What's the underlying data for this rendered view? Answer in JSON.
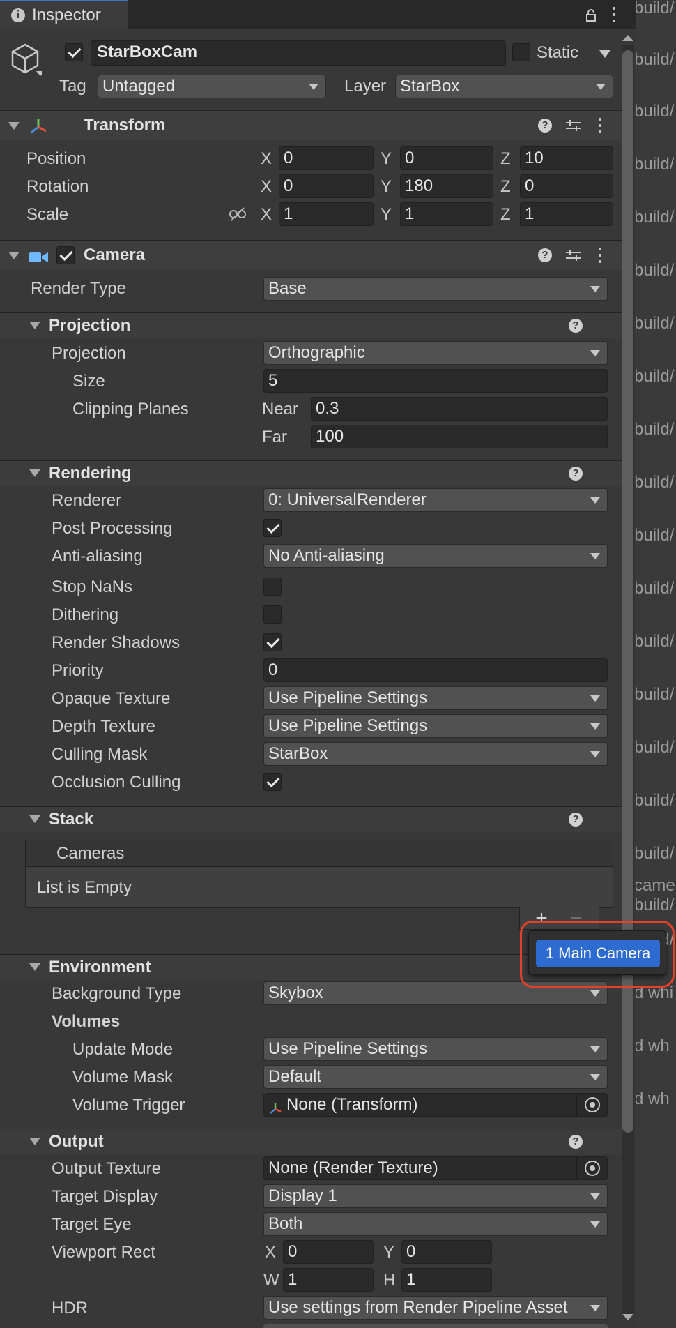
{
  "tab": {
    "title": "Inspector"
  },
  "gameobject": {
    "name": "StarBoxCam",
    "static_label": "Static",
    "tag_label": "Tag",
    "tag_value": "Untagged",
    "layer_label": "Layer",
    "layer_value": "StarBox"
  },
  "transform": {
    "title": "Transform",
    "rows": [
      {
        "label": "Position",
        "x": "0",
        "y": "0",
        "z": "10"
      },
      {
        "label": "Rotation",
        "x": "0",
        "y": "180",
        "z": "0"
      },
      {
        "label": "Scale",
        "x": "1",
        "y": "1",
        "z": "1"
      }
    ],
    "axis": {
      "x": "X",
      "y": "Y",
      "z": "Z"
    }
  },
  "camera": {
    "title": "Camera",
    "render_type_label": "Render Type",
    "render_type_value": "Base"
  },
  "projection": {
    "title": "Projection",
    "projection_label": "Projection",
    "projection_value": "Orthographic",
    "size_label": "Size",
    "size_value": "5",
    "clipping_label": "Clipping Planes",
    "near_label": "Near",
    "near_value": "0.3",
    "far_label": "Far",
    "far_value": "100"
  },
  "rendering": {
    "title": "Rendering",
    "renderer_label": "Renderer",
    "renderer_value": "0: UniversalRenderer",
    "post_label": "Post Processing",
    "aa_label": "Anti-aliasing",
    "aa_value": "No Anti-aliasing",
    "nan_label": "Stop NaNs",
    "dither_label": "Dithering",
    "shadows_label": "Render Shadows",
    "priority_label": "Priority",
    "priority_value": "0",
    "opaque_label": "Opaque Texture",
    "opaque_value": "Use Pipeline Settings",
    "depth_label": "Depth Texture",
    "depth_value": "Use Pipeline Settings",
    "culling_label": "Culling Mask",
    "culling_value": "StarBox",
    "occlusion_label": "Occlusion Culling"
  },
  "stack": {
    "title": "Stack",
    "list_header": "Cameras",
    "empty_text": "List is Empty",
    "plus": "+",
    "minus": "−"
  },
  "popup": {
    "item": "1 Main Camera"
  },
  "environment": {
    "title": "Environment",
    "bg_label": "Background Type",
    "bg_value": "Skybox",
    "volumes_label": "Volumes",
    "update_label": "Update Mode",
    "update_value": "Use Pipeline Settings",
    "mask_label": "Volume Mask",
    "mask_value": "Default",
    "trigger_label": "Volume Trigger",
    "trigger_value": "None (Transform)"
  },
  "output": {
    "title": "Output",
    "tex_label": "Output Texture",
    "tex_value": "None (Render Texture)",
    "display_label": "Target Display",
    "display_value": "Display 1",
    "eye_label": "Target Eye",
    "eye_value": "Both",
    "viewport_label": "Viewport Rect",
    "vx": "0",
    "vy": "0",
    "vw": "1",
    "vh": "1",
    "ax": "X",
    "ay": "Y",
    "aw": "W",
    "ah": "H",
    "hdr_label": "HDR",
    "hdr_value": "Use settings from Render Pipeline Asset"
  },
  "background_panel": {
    "lines": [
      "build/",
      "build/",
      "build/",
      "build/",
      "build/",
      "build/",
      "build/",
      "build/",
      "build/",
      "build/",
      "build/",
      "build/",
      "build/",
      "build/",
      "build/",
      "build/",
      "build/",
      "camer",
      "build/",
      "build/",
      "d whi",
      "d wh",
      "d wh"
    ]
  },
  "colors": {
    "accent": "#2e6bd0",
    "highlight": "#e5402a",
    "panel": "#383838"
  }
}
